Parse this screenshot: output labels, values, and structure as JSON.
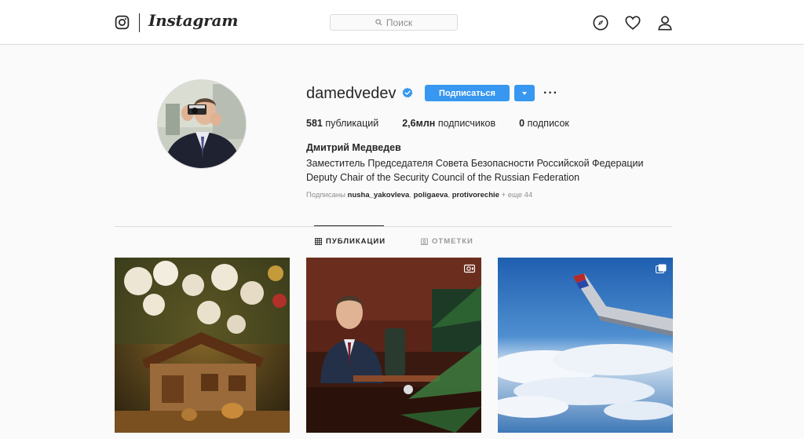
{
  "nav": {
    "brand": "Instagram",
    "search_placeholder": "Поиск",
    "icons": [
      "explore-compass-icon",
      "activity-heart-icon",
      "profile-person-icon"
    ]
  },
  "profile": {
    "username": "damedvedev",
    "verified": true,
    "follow_label": "Подписаться",
    "more_label": "···",
    "stats": {
      "posts_count": "581",
      "posts_label": "публикаций",
      "followers_count": "2,6млн",
      "followers_label": "подписчиков",
      "following_count": "0",
      "following_label": "подписок"
    },
    "full_name": "Дмитрий Медведев",
    "bio_line_1": "Заместитель Председателя Совета Безопасности Российской Федерации",
    "bio_line_2": "Deputy Chair of the Security Council of the Russian Federation",
    "followed_by": {
      "prefix": "Подписаны",
      "user_1": "nusha_yakovleva",
      "user_2": "poligaeva",
      "user_3": "protivorechie",
      "sep": ",",
      "suffix": "+ еще 44"
    }
  },
  "tabs": {
    "posts": "ПУБЛИКАЦИИ",
    "tagged": "ОТМЕТКИ"
  },
  "posts": [
    {
      "type": "photo",
      "badge": null
    },
    {
      "type": "video",
      "badge": "video-icon"
    },
    {
      "type": "carousel",
      "badge": "carousel-icon"
    }
  ],
  "colors": {
    "accent": "#3897f0",
    "verified": "#3897f0",
    "border": "#dbdbdb",
    "background": "#fafafa"
  }
}
